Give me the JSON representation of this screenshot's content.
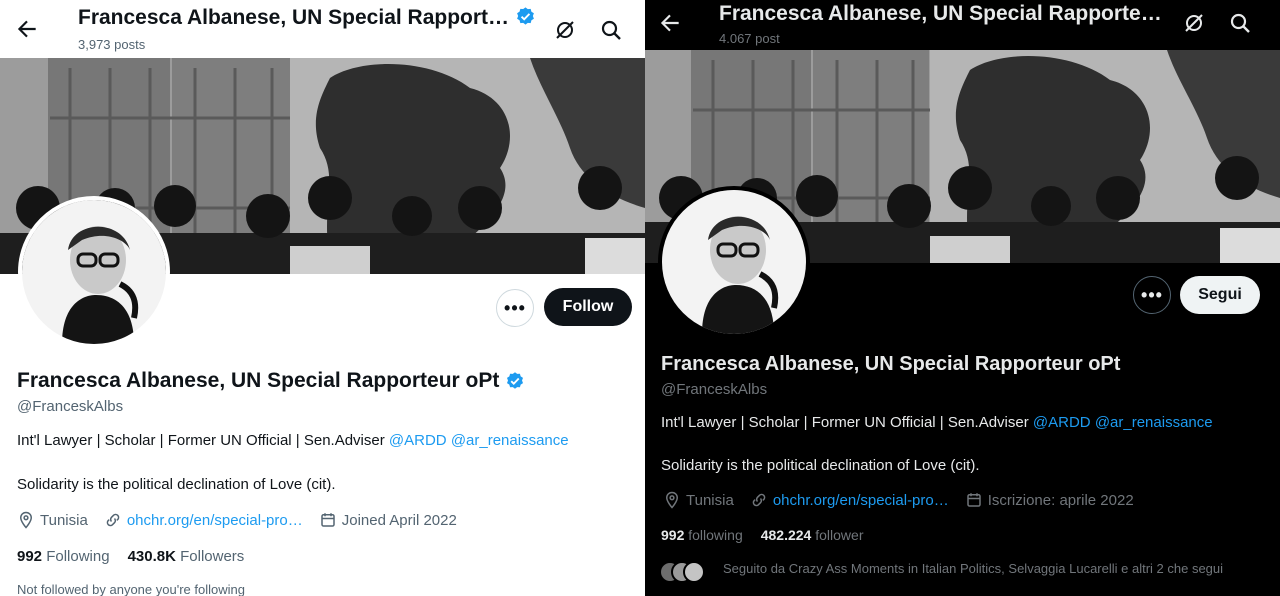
{
  "left": {
    "topbar": {
      "title": "Francesca Albanese, UN Special Rapport…",
      "posts": "3,973 posts"
    },
    "actions": {
      "follow_label": "Follow",
      "more_label": "•••"
    },
    "profile": {
      "name": "Francesca Albanese, UN Special Rapporteur oPt",
      "handle": "@FranceskAlbs",
      "bio_text": "Int'l Lawyer | Scholar | Former UN Official | Sen.Adviser ",
      "bio_mention_1": "@ARDD",
      "bio_mention_2": "@ar_renaissance",
      "quote": "Solidarity is the political declination of Love (cit).",
      "location": "Tunisia",
      "link": "ohchr.org/en/special-pro…",
      "joined": "Joined April 2022",
      "following_count": "992",
      "following_label": "Following",
      "followers_count": "430.8K",
      "followers_label": "Followers",
      "footer": "Not followed by anyone you're following"
    }
  },
  "right": {
    "topbar": {
      "title": "Francesca Albanese, UN Special Rapporte…",
      "posts": "4.067 post"
    },
    "actions": {
      "follow_label": "Segui",
      "more_label": "•••"
    },
    "profile": {
      "name": "Francesca Albanese, UN Special Rapporteur oPt",
      "handle": "@FranceskAlbs",
      "bio_text": "Int'l Lawyer | Scholar | Former UN Official | Sen.Adviser ",
      "bio_mention_1": "@ARDD",
      "bio_mention_2": "@ar_renaissance",
      "quote": "Solidarity is the political declination of Love (cit).",
      "location": "Tunisia",
      "link": "ohchr.org/en/special-pro…",
      "joined": "Iscrizione: aprile 2022",
      "following_count": "992",
      "following_label": "following",
      "followers_count": "482.224",
      "followers_label": "follower",
      "footer": "Seguito da Crazy Ass Moments in Italian Politics, Selvaggia Lucarelli e altri 2 che segui"
    }
  },
  "colors": {
    "accent": "#1d9bf0",
    "verified": "#1d9bf0",
    "dark_bg": "#000000",
    "light_bg": "#ffffff"
  },
  "icons": [
    "back-arrow-icon",
    "grok-icon",
    "search-icon",
    "verified-badge-icon",
    "location-icon",
    "link-icon",
    "calendar-icon"
  ]
}
